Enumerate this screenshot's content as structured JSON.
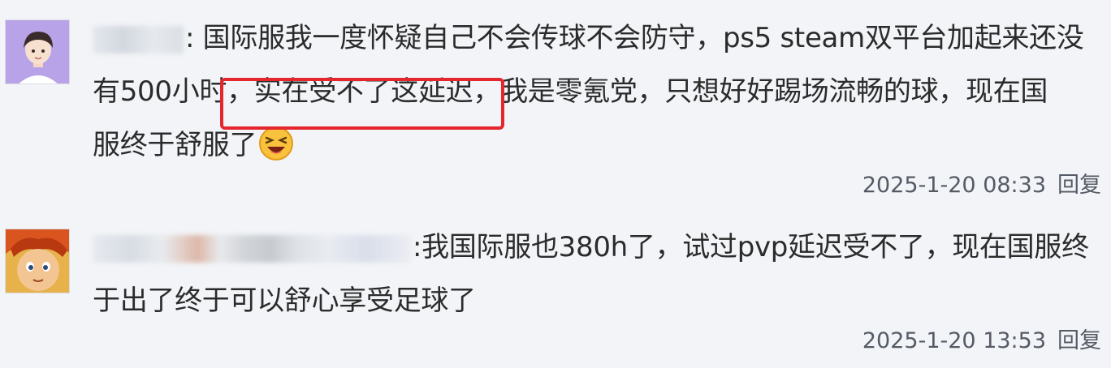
{
  "comments": [
    {
      "text_line1": ": 国际服我一度怀疑自己不会传球不会防守，ps5 steam双平台加起来还没",
      "text_line2_before": "有500小时",
      "text_line2_highlight": "，实在受不了这延迟，",
      "text_line2_after": "我是零氪党，只想好好踢场流畅的球，现在国",
      "text_line3": "服终于舒服了",
      "emoji_icon": "laughing-face-icon",
      "timestamp": "2025-1-20 08:33",
      "reply_label": "回复"
    },
    {
      "text_line1": ":我国际服也380h了，试过pvp延迟受不了，现在国服终",
      "text_line2": "于出了终于可以舒心享受足球了",
      "timestamp": "2025-1-20 13:53",
      "reply_label": "回复"
    }
  ],
  "colors": {
    "background": "#f2f4f7",
    "highlight_border": "#e5262c",
    "meta_text": "#555b66"
  }
}
